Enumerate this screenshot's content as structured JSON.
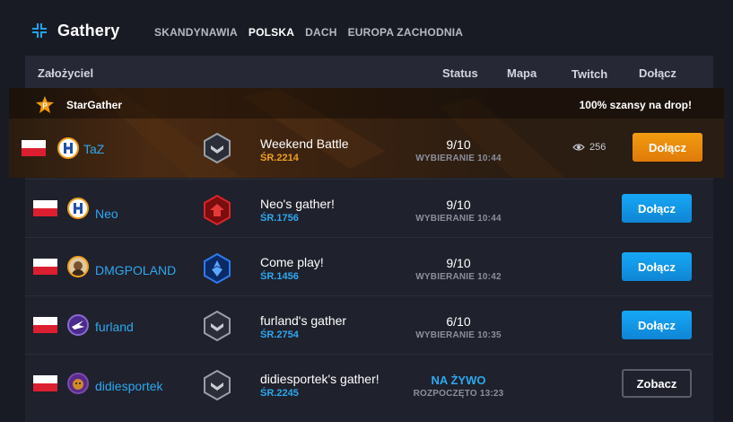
{
  "app": {
    "name": "Gathery"
  },
  "nav": [
    {
      "label": "SKANDYNAWIA",
      "active": false
    },
    {
      "label": "POLSKA",
      "active": true
    },
    {
      "label": "DACH",
      "active": false
    },
    {
      "label": "EUROPA ZACHODNIA",
      "active": false
    }
  ],
  "table": {
    "headers": {
      "founder": "Założyciel",
      "status": "Status",
      "map": "Mapa",
      "twitch": "Twitch",
      "join": "Dołącz"
    }
  },
  "promo": {
    "brand": "StarGather",
    "drop_text": "100% szansy na drop!"
  },
  "rows": [
    {
      "username": "TaZ",
      "title": "Weekend Battle",
      "sr": "ŚR.2214",
      "count": "9/10",
      "phase": "WYBIERANIE 10:44",
      "viewers": "256",
      "button": "Dołącz"
    },
    {
      "username": "Neo",
      "title": "Neo's gather!",
      "sr": "ŚR.1756",
      "count": "9/10",
      "phase": "WYBIERANIE 10:44",
      "button": "Dołącz"
    },
    {
      "username": "DMGPOLAND",
      "title": "Come play!",
      "sr": "ŚR.1456",
      "count": "9/10",
      "phase": "WYBIERANIE 10:42",
      "button": "Dołącz"
    },
    {
      "username": "furland",
      "title": "furland's gather",
      "sr": "ŚR.2754",
      "count": "6/10",
      "phase": "WYBIERANIE 10:35",
      "button": "Dołącz"
    },
    {
      "username": "didiesportek",
      "title": "didiesportek's gather!",
      "sr": "ŚR.2245",
      "count": "NA ŻYWO",
      "phase": "ROZPOCZĘTO 13:23",
      "button": "Zobacz"
    }
  ],
  "colors": {
    "accent_blue": "#2ea8f0",
    "accent_orange": "#f0a020",
    "background": "#191b24"
  }
}
